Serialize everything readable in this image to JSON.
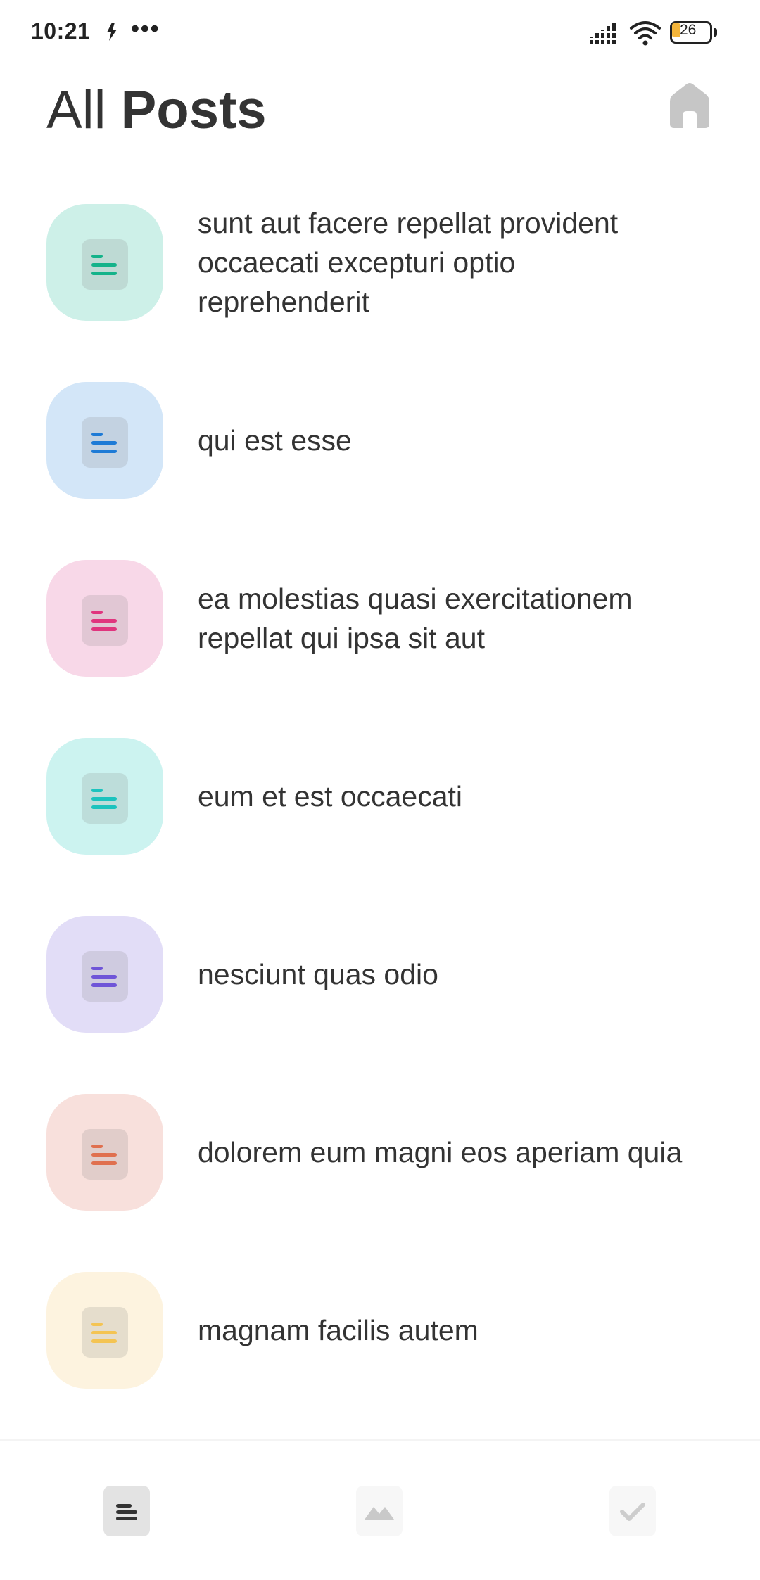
{
  "status_bar": {
    "time": "10:21",
    "more": "•••",
    "battery": "26",
    "battery_level": 0.26
  },
  "header": {
    "title_light": "All",
    "title_bold": "Posts",
    "home_icon": "home-icon"
  },
  "posts": [
    {
      "title": "sunt aut facere repellat provident occaecati excepturi optio reprehenderit",
      "bg": "#cdf0e8",
      "accent": "#14b38a"
    },
    {
      "title": "qui est esse",
      "bg": "#d3e6f8",
      "accent": "#1e7bd6"
    },
    {
      "title": "ea molestias quasi exercitationem repellat qui ipsa sit aut",
      "bg": "#f8d8e8",
      "accent": "#e0357e"
    },
    {
      "title": "eum et est occaecati",
      "bg": "#ccf3f0",
      "accent": "#1cc3be"
    },
    {
      "title": "nesciunt quas odio",
      "bg": "#e2ddf7",
      "accent": "#6f55d8"
    },
    {
      "title": "dolorem eum magni eos aperiam quia",
      "bg": "#f8e0dc",
      "accent": "#e0704f"
    },
    {
      "title": "magnam facilis autem",
      "bg": "#fdf3df",
      "accent": "#f4c453"
    }
  ],
  "bottom_nav": [
    {
      "name": "posts",
      "icon": "list-icon",
      "active": true
    },
    {
      "name": "photos",
      "icon": "image-icon",
      "active": false
    },
    {
      "name": "todos",
      "icon": "check-icon",
      "active": false
    }
  ]
}
